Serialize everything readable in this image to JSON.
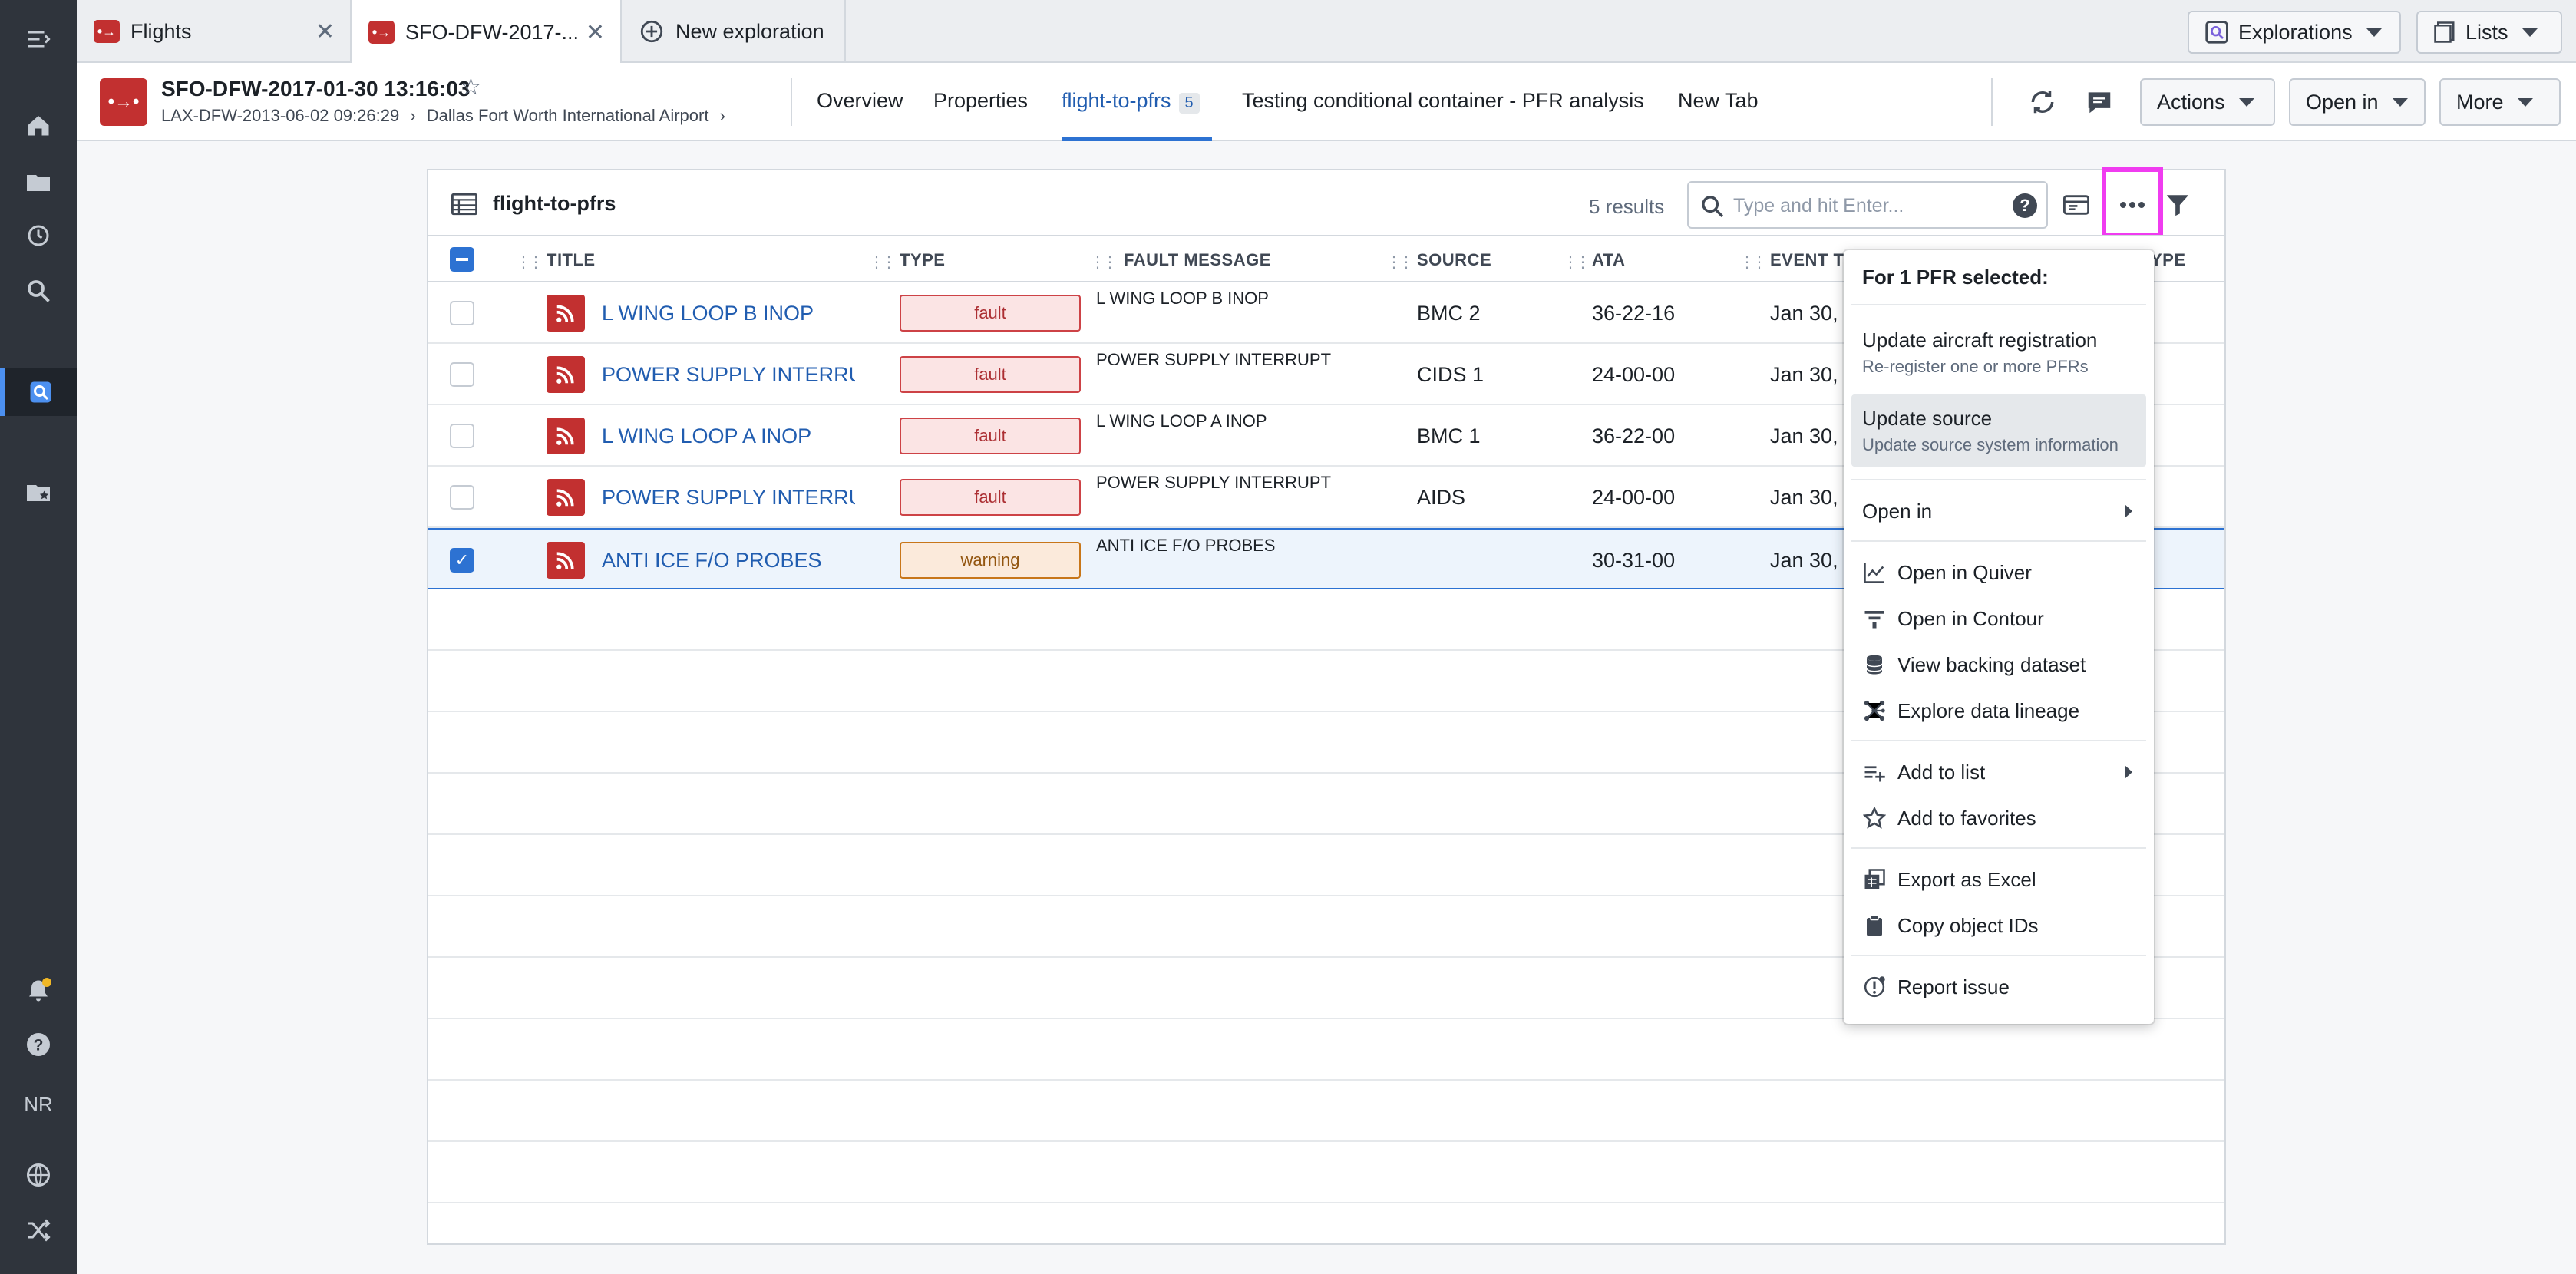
{
  "rail": {
    "user_initials": "NR"
  },
  "tabs": [
    {
      "label": "Flights"
    },
    {
      "label": "SFO-DFW-2017-..."
    },
    {
      "label": "New exploration"
    }
  ],
  "top_buttons": {
    "explorations": "Explorations",
    "lists": "Lists"
  },
  "header": {
    "title": "SFO-DFW-2017-01-30 13:16:03",
    "breadcrumb_1": "LAX-DFW-2013-06-02 09:26:29",
    "breadcrumb_2": "Dallas Fort Worth International Airport",
    "tabs": [
      {
        "label": "Overview"
      },
      {
        "label": "Properties"
      },
      {
        "label": "flight-to-pfrs",
        "count": "5"
      },
      {
        "label": "Testing conditional container - PFR analysis"
      },
      {
        "label": "New Tab"
      }
    ],
    "actions": "Actions",
    "open_in": "Open in",
    "more": "More"
  },
  "panel": {
    "title": "flight-to-pfrs",
    "results": "5 results",
    "search_placeholder": "Type and hit Enter...",
    "columns": [
      "TITLE",
      "TYPE",
      "FAULT MESSAGE",
      "SOURCE",
      "ATA",
      "EVENT TI",
      "YPE"
    ],
    "rows": [
      {
        "title": "L WING LOOP B INOP",
        "type": "fault",
        "fault_message": "L WING LOOP B INOP",
        "source": "BMC 2",
        "ata": "36-22-16",
        "event": "Jan 30, 2",
        "selected": false
      },
      {
        "title": "POWER SUPPLY INTERRU...",
        "type": "fault",
        "fault_message": "POWER SUPPLY INTERRUPT",
        "source": "CIDS 1",
        "ata": "24-00-00",
        "event": "Jan 30, 2",
        "selected": false
      },
      {
        "title": "L WING LOOP A INOP",
        "type": "fault",
        "fault_message": "L WING LOOP A INOP",
        "source": "BMC 1",
        "ata": "36-22-00",
        "event": "Jan 30, 2",
        "selected": false
      },
      {
        "title": "POWER SUPPLY INTERRU...",
        "type": "fault",
        "fault_message": "POWER SUPPLY INTERRUPT",
        "source": "AIDS",
        "ata": "24-00-00",
        "event": "Jan 30, 2",
        "selected": false
      },
      {
        "title": "ANTI ICE F/O PROBES",
        "type": "warning",
        "fault_message": "ANTI ICE F/O PROBES",
        "source": "",
        "ata": "30-31-00",
        "event": "Jan 30, 2",
        "selected": true
      }
    ]
  },
  "menu": {
    "heading": "For 1 PFR selected:",
    "update_registration": "Update aircraft registration",
    "update_registration_sub": "Re-register one or more PFRs",
    "update_source": "Update source",
    "update_source_sub": "Update source system information",
    "open_in": "Open in",
    "open_quiver": "Open in Quiver",
    "open_contour": "Open in Contour",
    "view_dataset": "View backing dataset",
    "explore_lineage": "Explore data lineage",
    "add_to_list": "Add to list",
    "add_favorites": "Add to favorites",
    "export_excel": "Export as Excel",
    "copy_ids": "Copy object IDs",
    "report_issue": "Report issue"
  },
  "colors": {
    "brand_red": "#c23030",
    "link_blue": "#215db0",
    "highlight_magenta": "#f03cf0",
    "fault_red": "#cd4246",
    "warning_orange": "#c87619"
  }
}
